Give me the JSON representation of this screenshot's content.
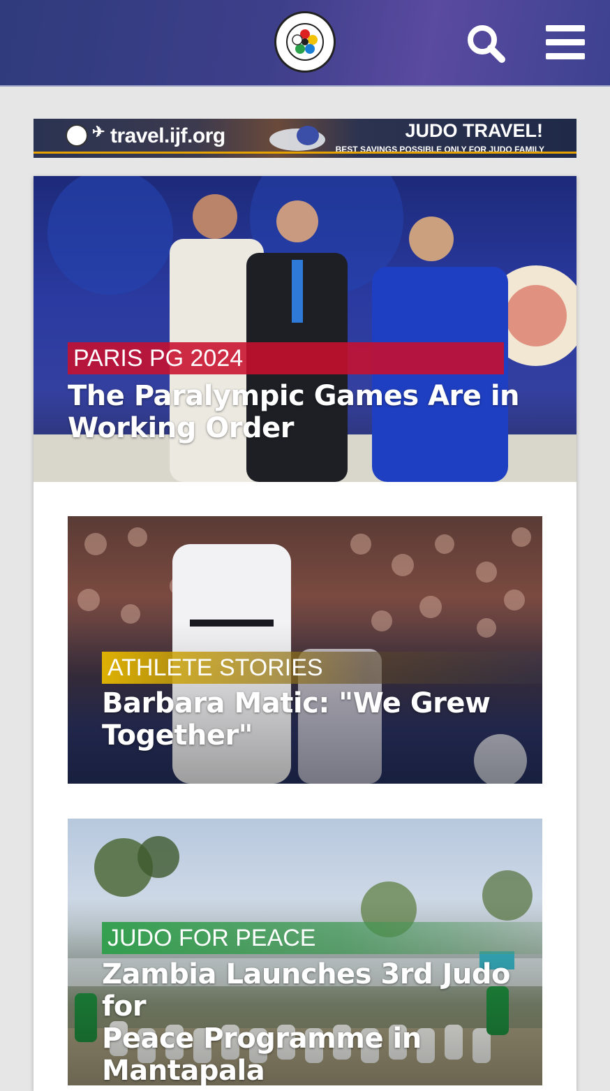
{
  "header": {
    "logo_alt": "International Judo Federation",
    "logo_ring_text": "INTERNATIONAL JUDO FEDERATION",
    "search_icon": "search-icon",
    "menu_icon": "hamburger-menu-icon"
  },
  "banner": {
    "url_text": "travel.ijf.org",
    "headline": "JUDO TRAVEL!",
    "subline": "BEST SAVINGS POSSIBLE ONLY FOR JUDO FAMILY",
    "plane_icon": "plane-icon"
  },
  "colors": {
    "header_bg": "#3e3f8a",
    "tag_red": "#c8102e",
    "tag_yellow": "#e6b800",
    "tag_green": "#2e9e4a"
  },
  "articles": [
    {
      "category": "PARIS PG 2024",
      "title": "The Paralympic Games Are in Working Order"
    },
    {
      "category": "ATHLETE STORIES",
      "title_line1": "Barbara Matic: \"We Grew",
      "title_line2": "Together\""
    },
    {
      "category": "JUDO FOR PEACE",
      "title_line1": "Zambia Launches 3rd Judo for",
      "title_line2": "Peace Programme in",
      "title_line3": "Mantapala"
    }
  ],
  "hero_title_line1": "The Paralympic Games Are in",
  "hero_title_line2": "Working Order"
}
